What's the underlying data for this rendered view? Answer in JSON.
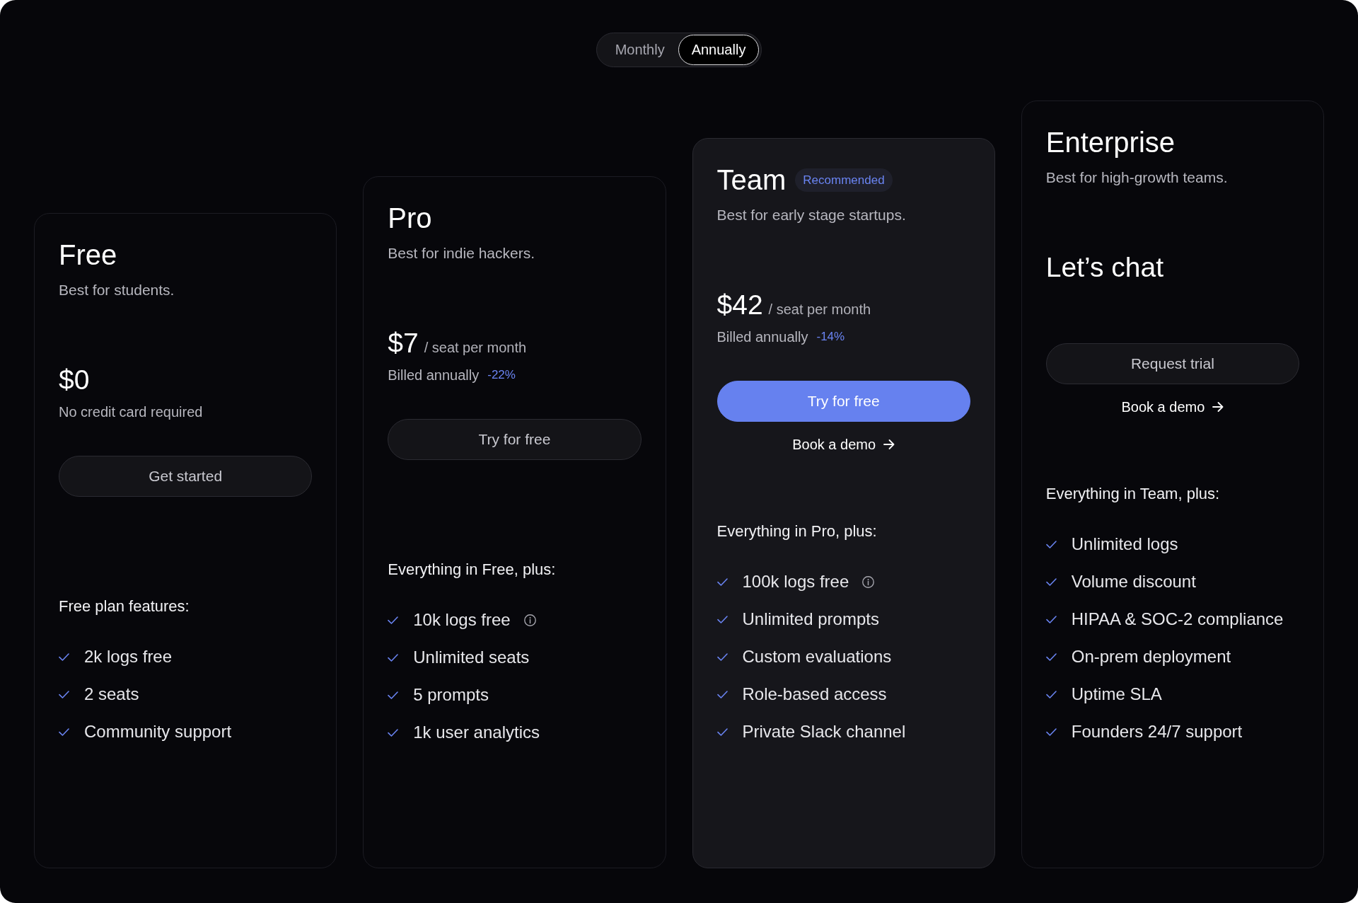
{
  "billing_toggle": [
    {
      "label": "Monthly",
      "selected": false
    },
    {
      "label": "Annually",
      "selected": true
    }
  ],
  "plans": [
    {
      "name": "Free",
      "highlighted": false,
      "tagline": "Best for students.",
      "price": "$0",
      "note": "No credit card required",
      "button": {
        "label": "Get started",
        "kind": "secondary"
      },
      "features_heading": "Free plan features:",
      "features": [
        {
          "text": "2k logs free",
          "info": false
        },
        {
          "text": "2 seats",
          "info": false
        },
        {
          "text": "Community support",
          "info": false
        }
      ]
    },
    {
      "name": "Pro",
      "highlighted": false,
      "tagline": "Best for indie hackers.",
      "price": "$7",
      "price_unit": "/ seat per month",
      "billing": "Billed annually",
      "discount": "-22%",
      "button": {
        "label": "Try for free",
        "kind": "secondary"
      },
      "features_heading": "Everything in Free, plus:",
      "features": [
        {
          "text": "10k logs free",
          "info": true
        },
        {
          "text": "Unlimited seats",
          "info": false
        },
        {
          "text": "5 prompts",
          "info": false
        },
        {
          "text": "1k user analytics",
          "info": false
        }
      ]
    },
    {
      "name": "Team",
      "highlighted": true,
      "badge": "Recommended",
      "tagline": "Best for early stage startups.",
      "price": "$42",
      "price_unit": "/ seat per month",
      "billing": "Billed annually",
      "discount": "-14%",
      "button": {
        "label": "Try for free",
        "kind": "primary"
      },
      "demo_link": "Book a demo",
      "features_heading": "Everything in Pro, plus:",
      "features": [
        {
          "text": "100k logs free",
          "info": true
        },
        {
          "text": "Unlimited prompts",
          "info": false
        },
        {
          "text": "Custom evaluations",
          "info": false
        },
        {
          "text": "Role-based access",
          "info": false
        },
        {
          "text": "Private Slack channel",
          "info": false
        }
      ]
    },
    {
      "name": "Enterprise",
      "highlighted": false,
      "tagline": "Best for high-growth teams.",
      "price": "Let’s chat",
      "button": {
        "label": "Request trial",
        "kind": "secondary"
      },
      "demo_link": "Book a demo",
      "features_heading": "Everything in Team, plus:",
      "features": [
        {
          "text": "Unlimited logs",
          "info": false
        },
        {
          "text": "Volume discount",
          "info": false
        },
        {
          "text": "HIPAA & SOC-2 compliance",
          "info": false
        },
        {
          "text": "On-prem deployment",
          "info": false
        },
        {
          "text": "Uptime SLA",
          "info": false
        },
        {
          "text": "Founders 24/7 support",
          "info": false
        }
      ]
    }
  ]
}
